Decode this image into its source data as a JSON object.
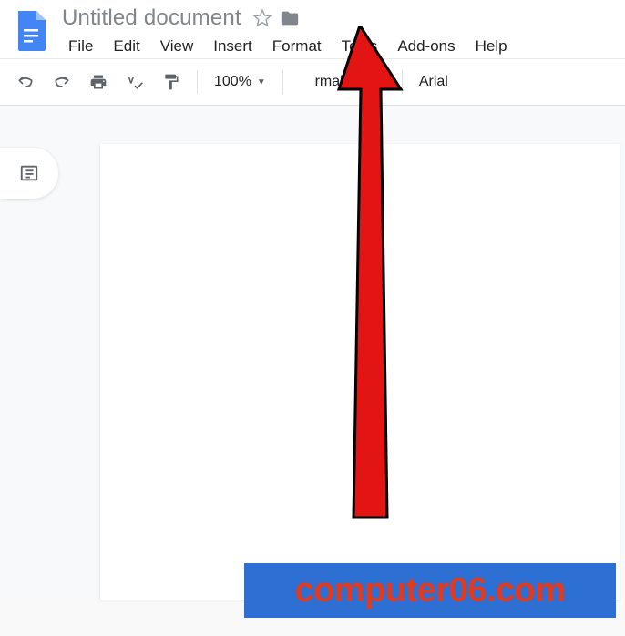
{
  "header": {
    "title": "Untitled document"
  },
  "menubar": {
    "items": [
      "File",
      "Edit",
      "View",
      "Insert",
      "Format",
      "Tools",
      "Add-ons",
      "Help"
    ]
  },
  "toolbar": {
    "zoom": "100%",
    "style": "rmal text",
    "font": "Arial"
  },
  "watermark": {
    "text": "computer06.com"
  }
}
